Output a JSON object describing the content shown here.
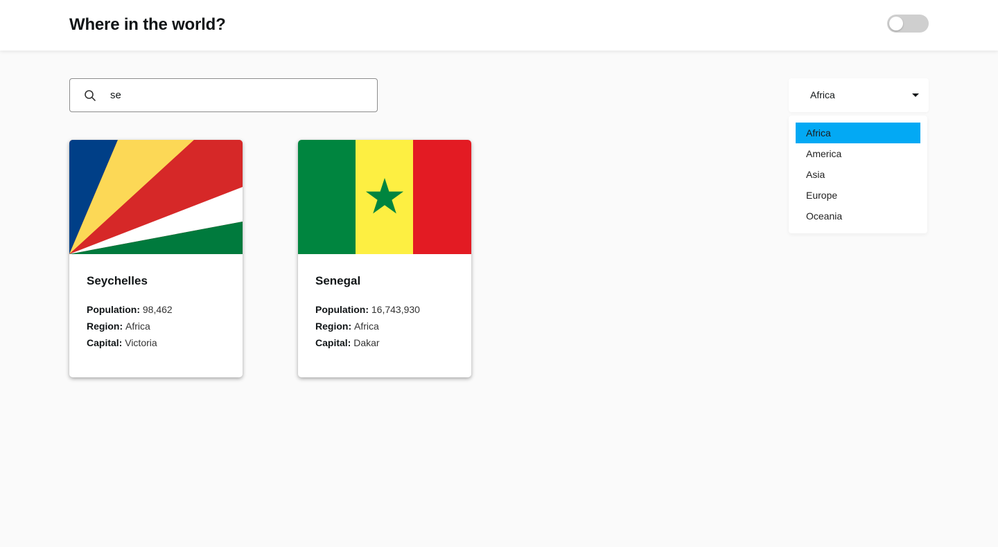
{
  "header": {
    "title": "Where in the world?"
  },
  "search": {
    "value": "se",
    "icon": "search-icon"
  },
  "filter": {
    "selected": "Africa",
    "options": [
      "Africa",
      "America",
      "Asia",
      "Europe",
      "Oceania"
    ],
    "highlight_color": "#03a9f4"
  },
  "labels": {
    "population": "Population:",
    "region": "Region:",
    "capital": "Capital:"
  },
  "countries": [
    {
      "name": "Seychelles",
      "population": "98,462",
      "region": "Africa",
      "capital": "Victoria",
      "flag": "seychelles-flag"
    },
    {
      "name": "Senegal",
      "population": "16,743,930",
      "region": "Africa",
      "capital": "Dakar",
      "flag": "senegal-flag"
    }
  ],
  "colors": {
    "background": "#fafafa",
    "surface": "#ffffff",
    "text": "#111517"
  }
}
